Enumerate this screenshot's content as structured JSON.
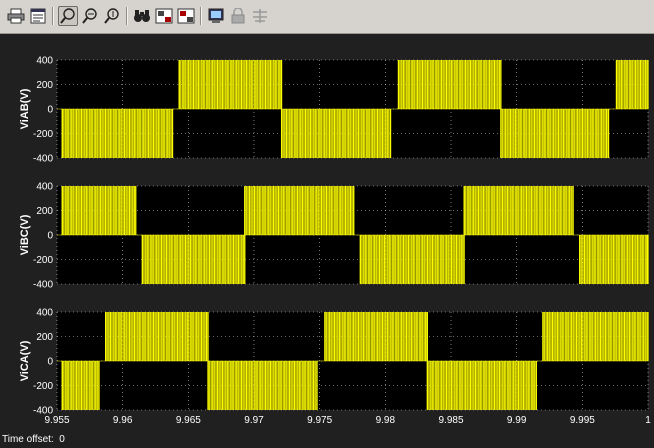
{
  "toolbar": {
    "buttons": [
      {
        "name": "print-icon",
        "tooltip": ""
      },
      {
        "name": "parameters-icon",
        "tooltip": ""
      },
      {
        "name": "zoom-icon",
        "tooltip": ""
      },
      {
        "name": "zoom-x-icon",
        "tooltip": ""
      },
      {
        "name": "zoom-y-icon",
        "tooltip": ""
      },
      {
        "name": "autoscale-icon",
        "tooltip": ""
      },
      {
        "name": "save-axes-icon",
        "tooltip": ""
      },
      {
        "name": "restore-axes-icon",
        "tooltip": ""
      },
      {
        "name": "floating-scope-icon",
        "tooltip": ""
      },
      {
        "name": "lock-axes-icon",
        "tooltip": ""
      },
      {
        "name": "signal-selection-icon",
        "tooltip": ""
      }
    ]
  },
  "colors": {
    "background": "#202020",
    "plot": "#000000",
    "trace": "#ffff00",
    "grid": "#ffffff",
    "text": "#ffffff",
    "toolbar": "#d6d3ce"
  },
  "status": {
    "label": "Time offset:",
    "value": "0"
  },
  "chart_data": [
    {
      "type": "line",
      "ylabel": "ViAB(V)",
      "ylim": [
        -400,
        400
      ],
      "yticks": [
        "400",
        "200",
        "0",
        "-200",
        "-400"
      ],
      "xlim": [
        9.955,
        10.0
      ],
      "xticks": [
        "9.955",
        "9.96",
        "9.965",
        "9.97",
        "9.975",
        "9.98",
        "9.985",
        "9.99",
        "9.995",
        "1"
      ],
      "pwm_blocks": [
        {
          "start": 9.9554,
          "end": 9.9638,
          "level": -400
        },
        {
          "start": 9.9643,
          "end": 9.9721,
          "level": 400
        },
        {
          "start": 9.9721,
          "end": 9.9804,
          "level": -400
        },
        {
          "start": 9.981,
          "end": 9.9888,
          "level": 400
        },
        {
          "start": 9.9888,
          "end": 9.997,
          "level": -400
        },
        {
          "start": 9.9976,
          "end": 10.0,
          "level": 400
        }
      ]
    },
    {
      "type": "line",
      "ylabel": "ViBC(V)",
      "ylim": [
        -400,
        400
      ],
      "yticks": [
        "400",
        "200",
        "0",
        "-200",
        "-400"
      ],
      "xlim": [
        9.955,
        10.0
      ],
      "xticks": [
        "9.955",
        "9.96",
        "9.965",
        "9.97",
        "9.975",
        "9.98",
        "9.985",
        "9.99",
        "9.995",
        "1"
      ],
      "pwm_blocks": [
        {
          "start": 9.9554,
          "end": 9.961,
          "level": 400
        },
        {
          "start": 9.9615,
          "end": 9.9693,
          "level": -400
        },
        {
          "start": 9.9693,
          "end": 9.9776,
          "level": 400
        },
        {
          "start": 9.9781,
          "end": 9.986,
          "level": -400
        },
        {
          "start": 9.986,
          "end": 9.9943,
          "level": 400
        },
        {
          "start": 9.9948,
          "end": 10.0,
          "level": -400
        }
      ]
    },
    {
      "type": "line",
      "ylabel": "ViCA(V)",
      "ylim": [
        -400,
        400
      ],
      "yticks": [
        "400",
        "200",
        "0",
        "-200",
        "-400"
      ],
      "xlim": [
        9.955,
        10.0
      ],
      "xticks": [
        "9.955",
        "9.96",
        "9.965",
        "9.97",
        "9.975",
        "9.98",
        "9.985",
        "9.99",
        "9.995",
        "1"
      ],
      "pwm_blocks": [
        {
          "start": 9.9554,
          "end": 9.9582,
          "level": -400
        },
        {
          "start": 9.9587,
          "end": 9.9665,
          "level": 400
        },
        {
          "start": 9.9665,
          "end": 9.9748,
          "level": -400
        },
        {
          "start": 9.9754,
          "end": 9.9832,
          "level": 400
        },
        {
          "start": 9.9832,
          "end": 9.9915,
          "level": -400
        },
        {
          "start": 9.992,
          "end": 10.0,
          "level": 400
        }
      ]
    }
  ]
}
